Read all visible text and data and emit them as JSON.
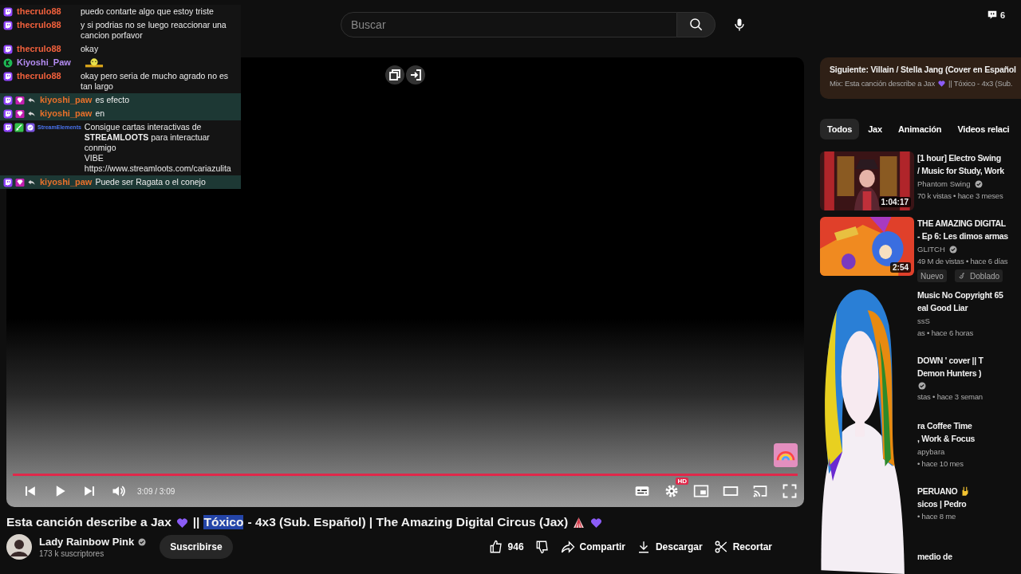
{
  "search": {
    "placeholder": "Buscar"
  },
  "chat_count": "6",
  "chat": {
    "messages": [
      {
        "kind": "twitch",
        "user": "thecrulo88",
        "color": "#f0603c",
        "text": "puedo contarte algo que estoy triste",
        "highlighted": false
      },
      {
        "kind": "twitch",
        "user": "thecrulo88",
        "color": "#f0603c",
        "text": "y si podrias no se luego reaccionar una cancion porfavor",
        "highlighted": false
      },
      {
        "kind": "twitch",
        "user": "thecrulo88",
        "color": "#f0603c",
        "text": "okay",
        "highlighted": false
      },
      {
        "kind": "k",
        "user": "Kiyoshi_Paw",
        "color": "#b48cf2",
        "emote": true,
        "highlighted": false
      },
      {
        "kind": "twitch",
        "user": "thecrulo88",
        "color": "#f0603c",
        "text": "okay pero seria de mucho agrado no es tan largo",
        "highlighted": false
      },
      {
        "kind": "reply",
        "user": "kiyoshi_paw",
        "color": "#e8702a",
        "text": "es efecto",
        "highlighted": true
      },
      {
        "kind": "reply",
        "user": "kiyoshi_paw",
        "color": "#e8702a",
        "text": "en",
        "highlighted": true
      },
      {
        "kind": "bot",
        "user": "StreamElements",
        "color": "#4a74f0",
        "text": "Consigue cartas interactivas de\n**STREAMLOOTS** para interactuar conmigo\nVIBE\nhttps://www.streamloots.com/cariazulita",
        "highlighted": false
      },
      {
        "kind": "reply",
        "user": "kiyoshi_paw",
        "color": "#e8702a",
        "text": "Puede ser Ragata o el conejo",
        "highlighted": true
      }
    ]
  },
  "player": {
    "time": "3:09 / 3:09",
    "level": 1,
    "hd": "HD"
  },
  "video": {
    "title": [
      {
        "kind": "text",
        "text": "Esta canción describe a Jax",
        "selected": false
      },
      {
        "kind": "heart"
      },
      {
        "kind": "text",
        "text": "||",
        "selected": false
      },
      {
        "kind": "text",
        "text": "Tóxico",
        "selected": true
      },
      {
        "kind": "text",
        "text": "- 4x3 (Sub. Español) | The Amazing Digital Circus (Jax)",
        "selected": false
      },
      {
        "kind": "tent"
      },
      {
        "kind": "heart"
      }
    ],
    "channel": "Lady Rainbow Pink",
    "verified": true,
    "subscribers": "173 k suscriptores",
    "subscribe": "Suscribirse",
    "likes": "946",
    "actions": [
      {
        "kind": "share",
        "label": "Compartir"
      },
      {
        "kind": "download",
        "label": "Descargar"
      },
      {
        "kind": "clip",
        "label": "Recortar"
      }
    ]
  },
  "up_next": {
    "title": "Siguiente: Villain / Stella Jang (Cover en Español",
    "mix": [
      {
        "kind": "text",
        "text": "Mix: Esta canción describe a Jax"
      },
      {
        "kind": "heart"
      },
      {
        "kind": "text",
        "text": "|| Tóxico - 4x3 (Sub."
      }
    ]
  },
  "tabs": [
    {
      "label": "Todos",
      "selected": true
    },
    {
      "label": "Jax",
      "selected": false
    },
    {
      "label": "Animación",
      "selected": false
    },
    {
      "label": "Videos relaci",
      "selected": false
    }
  ],
  "recommendations": [
    {
      "kind": "full",
      "duration": "1:04:17",
      "title_lines": [
        "[1 hour] Electro Swing",
        "/ Music for Study, Work"
      ],
      "channel": "Phantom Swing",
      "verified": true,
      "meta": "70 k vistas • hace 3 meses"
    },
    {
      "kind": "full",
      "duration": "2:54",
      "title_lines": [
        "THE AMAZING DIGITAL",
        "- Ep 6: Les dimos armas"
      ],
      "channel": "GLITCH",
      "verified": true,
      "meta": "49 M de vistas • hace 6 días",
      "tags": [
        "Nuevo",
        "Doblado"
      ]
    },
    {
      "kind": "hidden",
      "title_lines": [
        "Music No Copyright 65",
        "eal Good Liar"
      ],
      "channel": "ssS",
      "meta": "as • hace 6 horas"
    },
    {
      "kind": "hidden",
      "title_lines": [
        "DOWN ' cover || T",
        "Demon Hunters )"
      ],
      "verified": true,
      "meta": "stas • hace 3 seman"
    },
    {
      "kind": "hidden",
      "title_lines": [
        "ra Coffee Time",
        ", Work & Focus"
      ],
      "channel": "apybara",
      "meta": "• hace 10 mes"
    },
    {
      "kind": "hidden",
      "title_lines": [
        "PERUANO",
        "sicos | Pedro"
      ],
      "hand": true,
      "meta": "• hace 8 me"
    },
    {
      "kind": "hidden",
      "title_lines": [
        "medio de"
      ]
    }
  ]
}
